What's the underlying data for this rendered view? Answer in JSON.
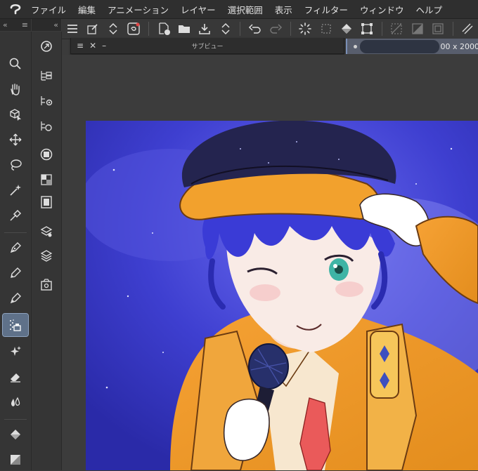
{
  "menu": {
    "items": [
      "ファイル",
      "編集",
      "アニメーション",
      "レイヤー",
      "選択範囲",
      "表示",
      "フィルター",
      "ウィンドウ",
      "ヘルプ"
    ]
  },
  "panels": {
    "left_collapse": "«",
    "left_menu": "≡",
    "sub_collapse": "«"
  },
  "subview": {
    "title": "サブビュー",
    "menu_icon": "≡",
    "close_label": "✕",
    "minimize_label": "–"
  },
  "document_tab": {
    "size_text": "00 x 2000"
  },
  "tools": [
    {
      "name": "zoom",
      "icon": "magnifier-icon"
    },
    {
      "name": "hand",
      "icon": "hand-icon"
    },
    {
      "name": "object-select",
      "icon": "object-icon"
    },
    {
      "name": "move",
      "icon": "move-icon"
    },
    {
      "name": "lasso",
      "icon": "lasso-icon"
    },
    {
      "name": "auto-select",
      "icon": "magic-wand-icon"
    },
    {
      "name": "eyedropper",
      "icon": "eyedropper-icon"
    },
    {
      "name": "pen",
      "icon": "pen-icon"
    },
    {
      "name": "pencil",
      "icon": "pencil-icon"
    },
    {
      "name": "brush",
      "icon": "brush-icon"
    },
    {
      "name": "airbrush",
      "icon": "airbrush-icon",
      "active": true
    },
    {
      "name": "decoration",
      "icon": "sparkle-icon"
    },
    {
      "name": "eraser",
      "icon": "eraser-icon"
    },
    {
      "name": "blend",
      "icon": "blend-icon"
    },
    {
      "name": "fill",
      "icon": "fill-icon"
    },
    {
      "name": "color",
      "icon": "color-swatch-icon"
    }
  ],
  "colors": {
    "accent": "#5f7189",
    "background": "#3b3b3b",
    "panel": "#353535"
  }
}
